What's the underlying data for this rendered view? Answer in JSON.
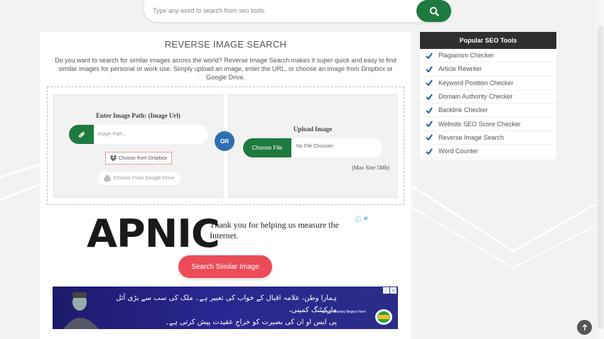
{
  "search": {
    "placeholder": "Type any word to search from seo tools"
  },
  "main": {
    "title": "REVERSE IMAGE SEARCH",
    "description": "Do you want to search for similar images across the world? Reverse Image Search makes it super quick and easy to find similar images for personal or work use. Simply upload an image, enter the URL, or choose an image from Dropbox or Google Drive.",
    "url_panel": {
      "title": "Enter Image Path: (Image Url)",
      "input_placeholder": "Image Path...",
      "dropbox_label": "Choose from Dropbox",
      "gdrive_label": "Choose From Google Drive"
    },
    "or_label": "OR",
    "upload_panel": {
      "title": "Upload Image",
      "choose_file_label": "Choose File",
      "file_status": "No File Choosen",
      "max_size": "(Max Size 5Mb)"
    },
    "ad": {
      "brand": "APNIC",
      "message": "Thank you for helping us measure the Internet."
    },
    "search_button": "Search Similar Image",
    "banner": {
      "line1": "ہمارا وطن، علامہ اقبال کے خواب کی تعبیر ہے۔ ملک کی سب سے بڑی آئل مارکیٹنگ کمپنی،",
      "line2": "پی ایس او ان کی بصیرت کو خراجِ عقیدت پیش کرتی ہے۔",
      "tagline": "Every Journey Begins Here"
    }
  },
  "sidebar": {
    "title": "Popular SEO Tools",
    "items": [
      "Plagiarism Checker",
      "Article Rewriter",
      "Keyword Position Checker",
      "Domain Authority Checker",
      "Backlink Checker",
      "Website SEO Score Checker",
      "Reverse Image Search",
      "Word Counter"
    ]
  },
  "colors": {
    "green": "#1e7a3e",
    "blue": "#2e6fb4",
    "red": "#ec4c57",
    "dark": "#2f2f2f"
  }
}
